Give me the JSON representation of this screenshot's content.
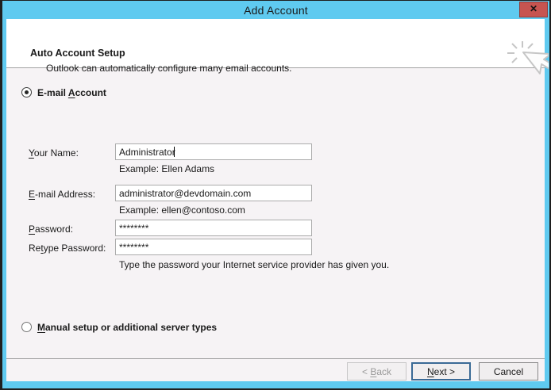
{
  "window": {
    "title": "Add Account",
    "close_glyph": "✕"
  },
  "header": {
    "title": "Auto Account Setup",
    "subtitle": "Outlook can automatically configure many email accounts."
  },
  "radios": {
    "email_account": {
      "pre": "E-mail ",
      "accel": "A",
      "rest": "ccount",
      "state": "selected"
    },
    "manual": {
      "pre": "",
      "accel": "M",
      "rest": "anual setup or additional server types",
      "state": "unselected"
    }
  },
  "fields": {
    "your_name": {
      "pre": "",
      "accel": "Y",
      "rest": "our Name:",
      "value": "Administrator",
      "example": "Example: Ellen Adams"
    },
    "email": {
      "pre": "",
      "accel": "E",
      "rest": "-mail Address:",
      "value": "administrator@devdomain.com",
      "example": "Example: ellen@contoso.com"
    },
    "password": {
      "pre": "",
      "accel": "P",
      "rest": "assword:",
      "value": "********"
    },
    "retype": {
      "pre": "Re",
      "accel": "t",
      "rest": "ype Password:",
      "value": "********"
    },
    "hint": "Type the password your Internet service provider has given you."
  },
  "buttons": {
    "back": {
      "pre": "< ",
      "accel": "B",
      "rest": "ack"
    },
    "next": {
      "pre": "",
      "accel": "N",
      "rest": "ext >"
    },
    "cancel": {
      "pre": "",
      "accel": "",
      "rest": "Cancel"
    }
  },
  "colors": {
    "titlebar_blue": "#5FCAF0",
    "close_red": "#C75450",
    "header_bg": "#FFFFFF",
    "body_bg": "#F6F3F5",
    "focus_border": "#3A6A96",
    "input_border": "#ABABAB"
  }
}
